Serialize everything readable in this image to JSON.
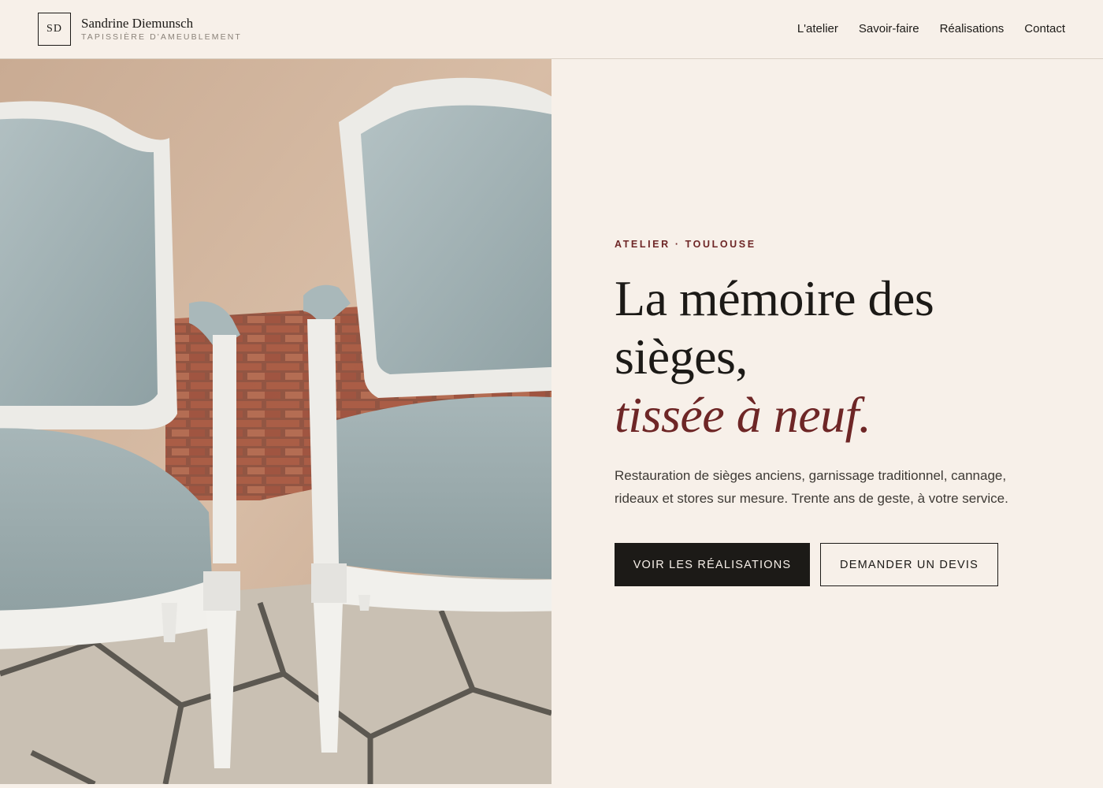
{
  "header": {
    "monogram": "SD",
    "brand_name": "Sandrine Diemunsch",
    "brand_tagline": "TAPISSIÈRE D'AMEUBLEMENT",
    "nav": [
      {
        "label": "L'atelier"
      },
      {
        "label": "Savoir-faire"
      },
      {
        "label": "Réalisations"
      },
      {
        "label": "Contact"
      }
    ]
  },
  "hero": {
    "eyebrow": "ATELIER · TOULOUSE",
    "headline_line1": "La mémoire des",
    "headline_line2": "sièges,",
    "headline_accent": "tissée à neuf.",
    "lede": "Restauration de sièges anciens, garnissage traditionnel, cannage, rideaux et stores sur mesure. Trente ans de geste, à votre service.",
    "primary_cta": "VOIR LES RÉALISATIONS",
    "secondary_cta": "DEMANDER UN DEVIS",
    "image": "photo of two white Louis XVI armchairs upholstered in pale blue-grey fabric"
  },
  "colors": {
    "background": "#f7f0e9",
    "ink": "#1c1a17",
    "accent": "#6e2626",
    "muted": "#8a8279",
    "border": "#d9d0c4"
  }
}
